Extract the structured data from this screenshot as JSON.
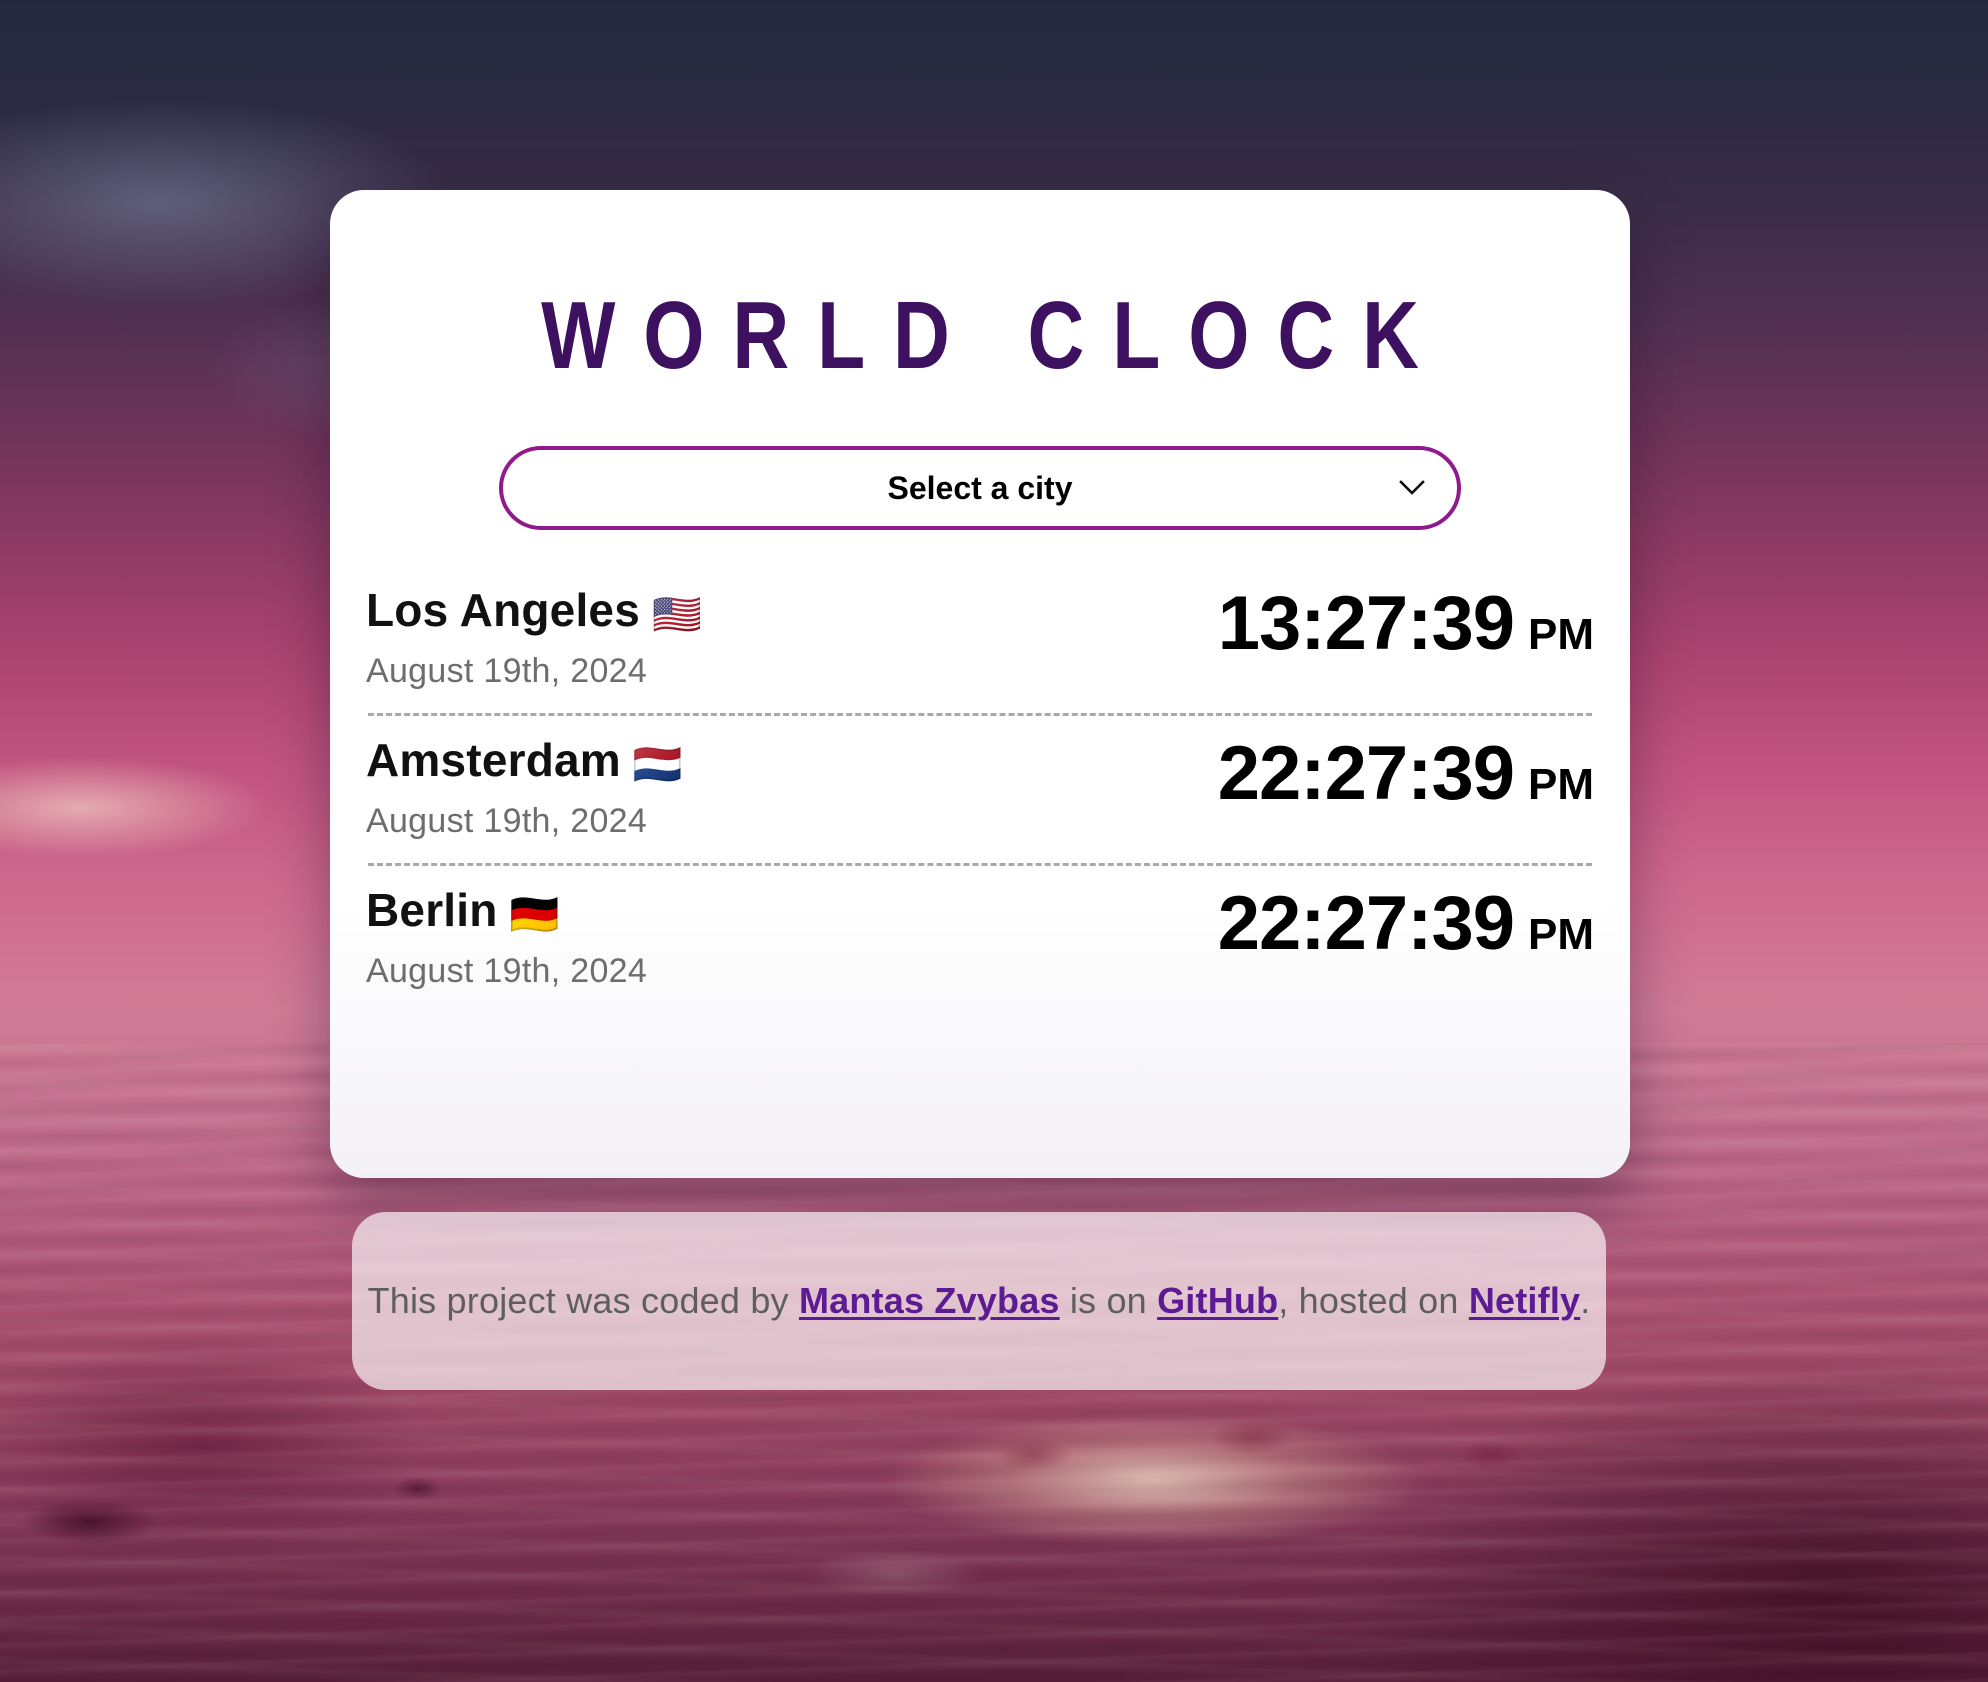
{
  "app": {
    "title": "WORLD CLOCK",
    "title_color": "#3d1160"
  },
  "select": {
    "placeholder": "Select a city",
    "selected": "Select a city",
    "border_color": "#8e1a8e",
    "chevron_icon": "chevron-down-icon",
    "options": [
      "Select a city",
      "Los Angeles",
      "Amsterdam",
      "Berlin"
    ]
  },
  "cities": [
    {
      "name": "Los Angeles",
      "flag": "🇺🇸",
      "date": "August 19th, 2024",
      "time": "13:27:39",
      "meridiem": "PM"
    },
    {
      "name": "Amsterdam",
      "flag": "🇳🇱",
      "date": "August 19th, 2024",
      "time": "22:27:39",
      "meridiem": "PM"
    },
    {
      "name": "Berlin",
      "flag": "🇩🇪",
      "date": "August 19th, 2024",
      "time": "22:27:39",
      "meridiem": "PM"
    }
  ],
  "footer": {
    "prefix": "This project was coded by ",
    "author_link": "Mantas Zvybas",
    "middle": " is on ",
    "repo_link": "GitHub",
    "middle2": ", hosted on ",
    "host_link": "Netifly",
    "suffix": ".",
    "link_color": "#5c1a93",
    "text_color": "#5e5e5e"
  }
}
